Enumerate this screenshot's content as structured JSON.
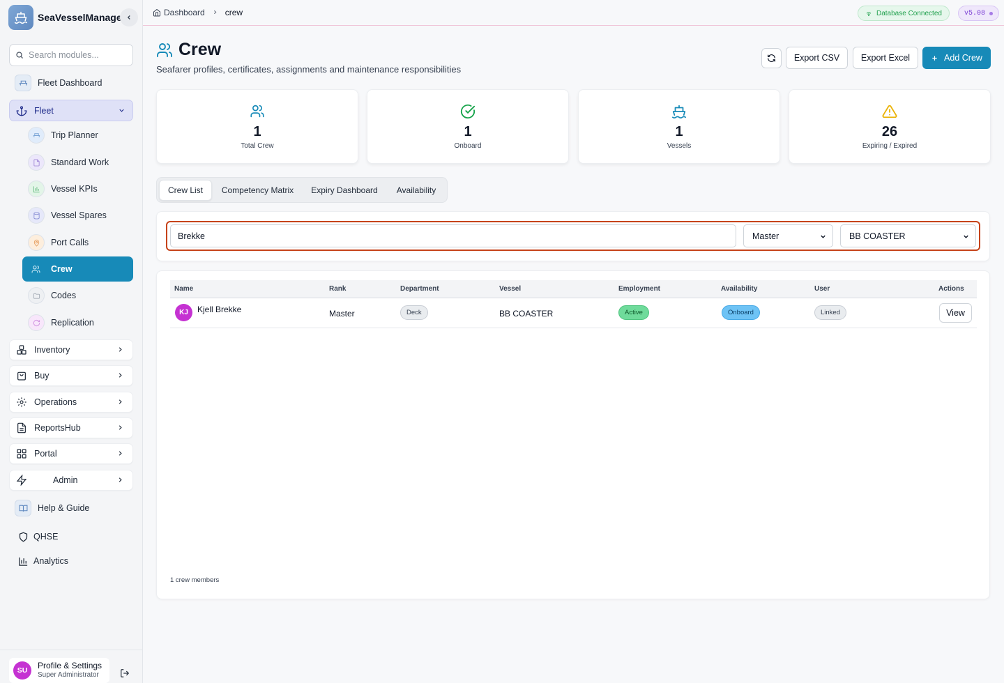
{
  "brand": {
    "name": "SeaVesselManager"
  },
  "sidebar": {
    "search_placeholder": "Search modules...",
    "dashboard": "Fleet Dashboard",
    "fleet_group": "Fleet",
    "fleet_items": [
      {
        "label": "Trip Planner",
        "color": "#dbeafe"
      },
      {
        "label": "Standard Work",
        "color": "#ede9fe"
      },
      {
        "label": "Vessel KPIs",
        "color": "#dcfce7"
      },
      {
        "label": "Vessel Spares",
        "color": "#e0e7ff"
      },
      {
        "label": "Port Calls",
        "color": "#ffedd5"
      },
      {
        "label": "Crew",
        "color": "#178ab8"
      },
      {
        "label": "Codes",
        "color": "#f1f5f9"
      },
      {
        "label": "Replication",
        "color": "#fae8ff"
      }
    ],
    "groups": [
      "Inventory",
      "Buy",
      "Operations",
      "ReportsHub",
      "Portal",
      "Admin"
    ],
    "help": "Help & Guide",
    "qhse": "QHSE",
    "analytics": "Analytics",
    "profile": {
      "initials": "SU",
      "name": "Profile & Settings",
      "role": "Super Administrator"
    }
  },
  "topbar": {
    "breadcrumb_home": "Dashboard",
    "breadcrumb_current": "crew",
    "db_status": "Database Connected",
    "version": "v5.08"
  },
  "header": {
    "title": "Crew",
    "subtitle": "Seafarer profiles, certificates, assignments and maintenance responsibilities",
    "export_csv": "Export CSV",
    "export_excel": "Export Excel",
    "add_crew": "Add Crew"
  },
  "stats": [
    {
      "value": "1",
      "label": "Total Crew",
      "color": "#178ab8"
    },
    {
      "value": "1",
      "label": "Onboard",
      "color": "#16a34a"
    },
    {
      "value": "1",
      "label": "Vessels",
      "color": "#178ab8"
    },
    {
      "value": "26",
      "label": "Expiring / Expired",
      "color": "#eab308"
    }
  ],
  "tabs": [
    "Crew List",
    "Competency Matrix",
    "Expiry Dashboard",
    "Availability"
  ],
  "filters": {
    "search_value": "Brekke",
    "rank_selected": "Master",
    "vessel_selected": "BB COASTER"
  },
  "table": {
    "columns": [
      "Name",
      "Rank",
      "Department",
      "Vessel",
      "Employment",
      "Availability",
      "User",
      "Actions"
    ],
    "rows": [
      {
        "initials": "KJ",
        "name": "Kjell Brekke",
        "rank": "Master",
        "department": "Deck",
        "vessel": "BB COASTER",
        "employment": "Active",
        "availability": "Onboard",
        "user": "Linked",
        "action": "View"
      }
    ],
    "count_text": "1 crew members"
  }
}
